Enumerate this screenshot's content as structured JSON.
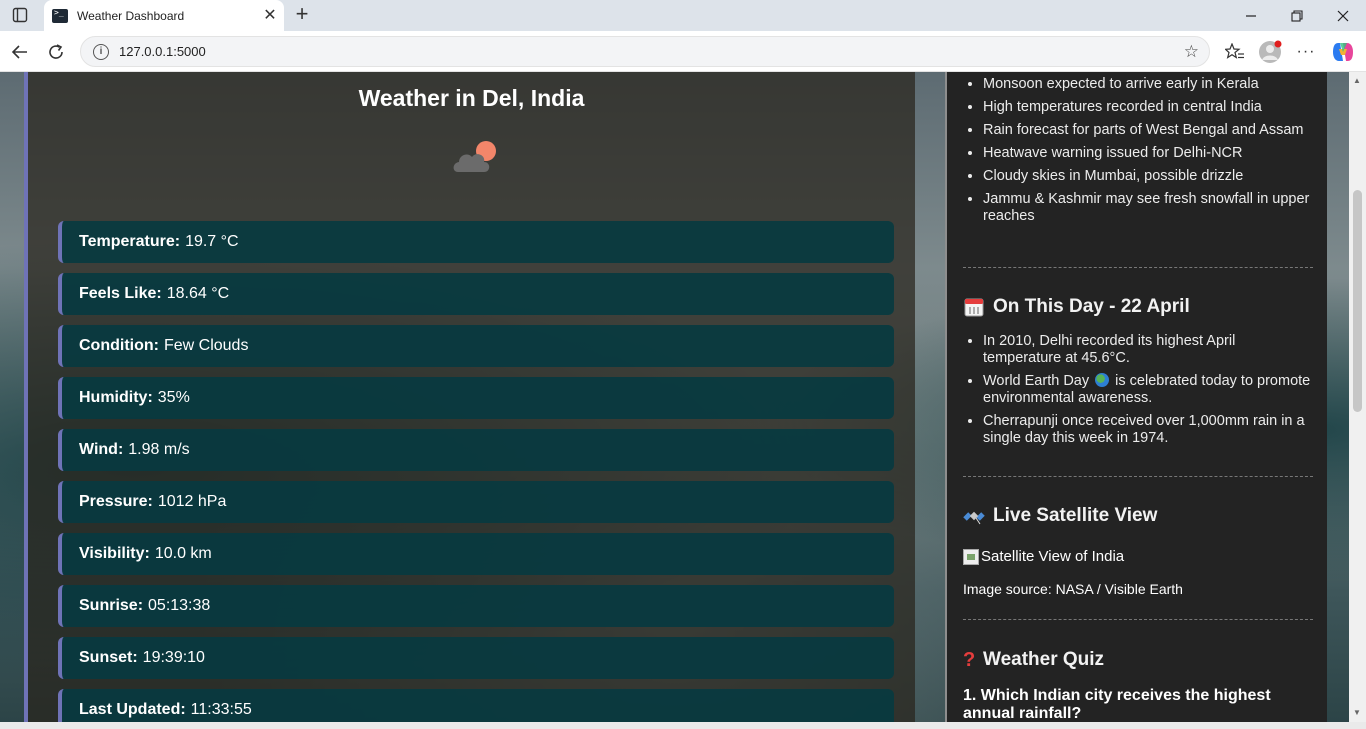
{
  "browser": {
    "tab_title": "Weather Dashboard",
    "url": "127.0.0.1:5000"
  },
  "main": {
    "title": "Weather in Del, India",
    "icon": "cloud-sun-icon",
    "cards": [
      {
        "label": "Temperature:",
        "value": "19.7 °C"
      },
      {
        "label": "Feels Like:",
        "value": "18.64 °C"
      },
      {
        "label": "Condition:",
        "value": "Few Clouds"
      },
      {
        "label": "Humidity:",
        "value": "35%"
      },
      {
        "label": "Wind:",
        "value": "1.98 m/s"
      },
      {
        "label": "Pressure:",
        "value": "1012 hPa"
      },
      {
        "label": "Visibility:",
        "value": "10.0 km"
      },
      {
        "label": "Sunrise:",
        "value": "05:13:38"
      },
      {
        "label": "Sunset:",
        "value": "19:39:10"
      },
      {
        "label": "Last Updated:",
        "value": "11:33:55"
      }
    ]
  },
  "side": {
    "news": [
      "Monsoon expected to arrive early in Kerala",
      "High temperatures recorded in central India",
      "Rain forecast for parts of West Bengal and Assam",
      "Heatwave warning issued for Delhi-NCR",
      "Cloudy skies in Mumbai, possible drizzle",
      "Jammu & Kashmir may see fresh snowfall in upper reaches"
    ],
    "on_this_day": {
      "title": "On This Day - 22 April",
      "icon": "calendar-icon",
      "items": [
        "In 2010, Delhi recorded its highest April temperature at 45.6°C.",
        "World Earth Day",
        "is celebrated today to promote environmental awareness.",
        "Cherrapunji once received over 1,000mm rain in a single day this week in 1974."
      ]
    },
    "satellite": {
      "title": "Live Satellite View",
      "icon": "satellite-icon",
      "alt": "Satellite View of India",
      "source": "Image source: NASA / Visible Earth"
    },
    "quiz": {
      "title": "Weather Quiz",
      "icon": "question-mark-icon",
      "question": "1. Which Indian city receives the highest annual rainfall?"
    }
  }
}
